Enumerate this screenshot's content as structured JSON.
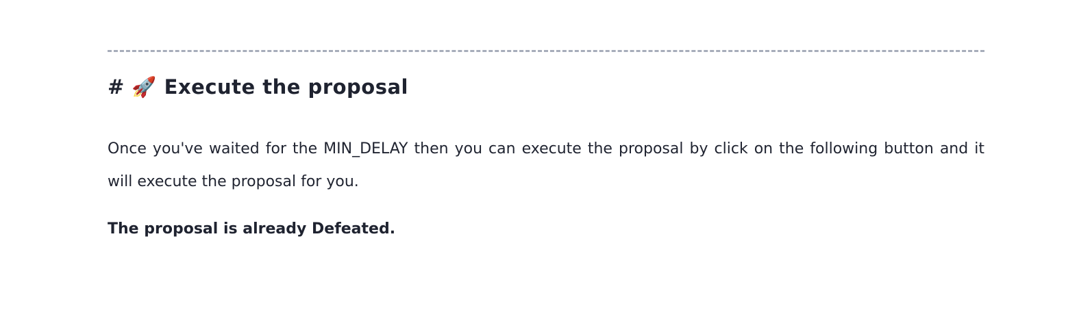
{
  "section": {
    "heading_hash": "#",
    "heading_icon": "🚀",
    "heading": "Execute the proposal",
    "paragraph": "Once you've waited for the MIN_DELAY then you can execute the proposal by click on the following button and it will execute the proposal for you.",
    "status": "The proposal is already Defeated."
  }
}
